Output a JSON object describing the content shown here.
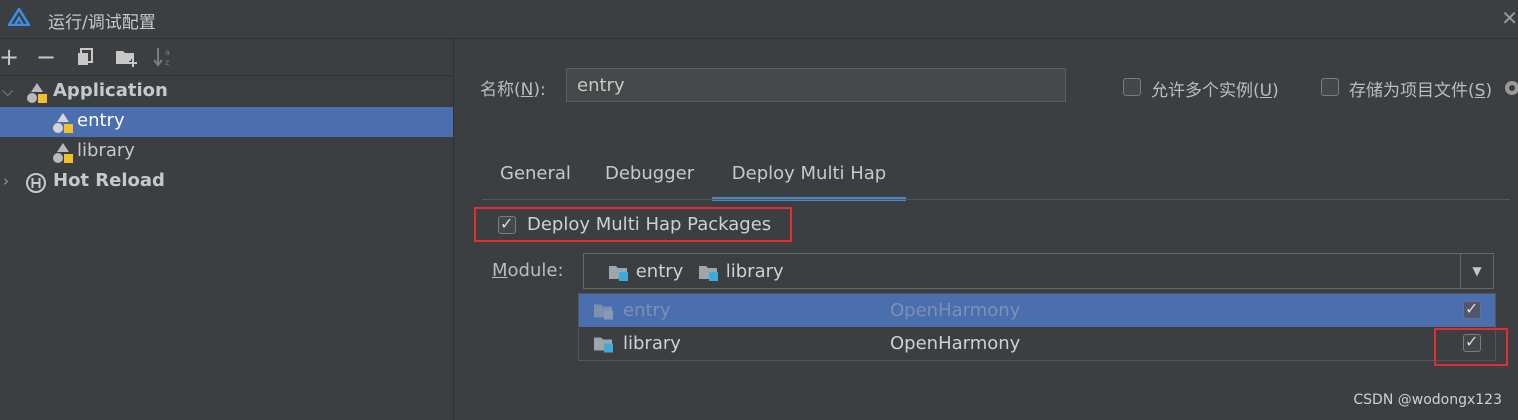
{
  "window": {
    "title": "运行/调试配置"
  },
  "toolbar": {
    "add": "+",
    "remove": "−"
  },
  "tree": {
    "application": "Application",
    "entry": "entry",
    "library": "library",
    "hot_reload": "Hot Reload"
  },
  "form": {
    "name_label_prefix": "名称(",
    "name_label_mnemonic": "N",
    "name_label_suffix": "):",
    "name_value": "entry",
    "allow_multi_prefix": "允许多个实例(",
    "allow_multi_mnemonic": "U",
    "allow_multi_suffix": ")",
    "store_file_prefix": "存储为项目文件(",
    "store_file_mnemonic": "S",
    "store_file_suffix": ")"
  },
  "tabs": [
    "General",
    "Debugger",
    "Deploy Multi Hap"
  ],
  "deploy": {
    "checkbox_label": "Deploy Multi Hap Packages",
    "checked": true,
    "module_label_mnemonic": "M",
    "module_label_rest": "odule:",
    "selected_modules": [
      "entry",
      "library"
    ],
    "options": [
      {
        "name": "entry",
        "type": "OpenHarmony",
        "checked": true
      },
      {
        "name": "library",
        "type": "OpenHarmony",
        "checked": true
      }
    ]
  },
  "watermark": "CSDN @wodongx123",
  "colors": {
    "selection": "#4b6eaf",
    "accent": "#4a88c7",
    "highlight_box": "#e02f2f",
    "folder_badge": "#3fa9dc"
  }
}
